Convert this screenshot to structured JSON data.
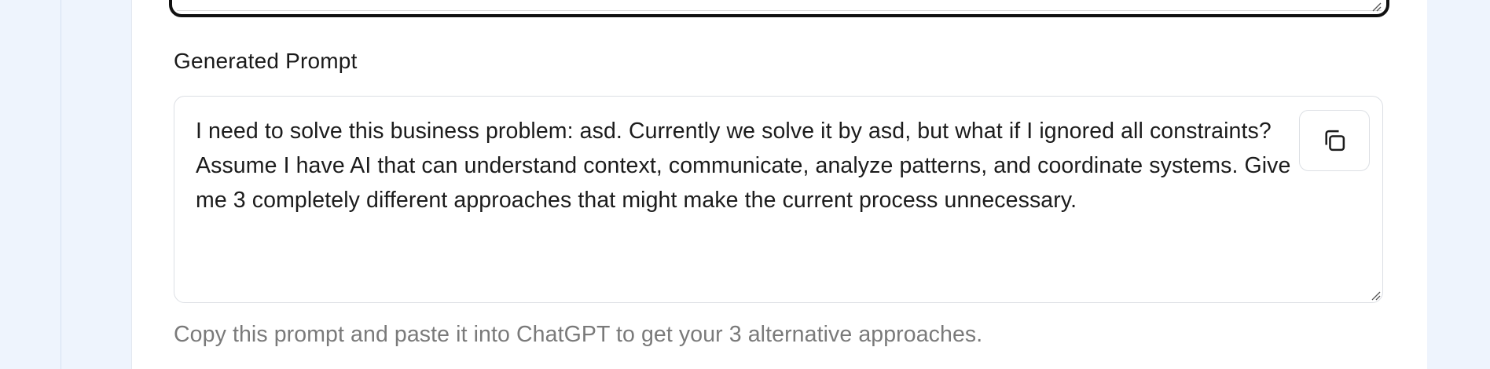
{
  "generated_prompt": {
    "label": "Generated Prompt",
    "text": "I need to solve this business problem: asd. Currently we solve it by asd, but what if I ignored all constraints? Assume I have AI that can understand context, communicate, analyze patterns, and coordinate systems. Give me 3 completely different approaches that might make the current process unnecessary.",
    "copy_icon": "copy-icon",
    "helper": "Copy this prompt and paste it into ChatGPT to get your 3 alternative approaches."
  },
  "colors": {
    "page_background": "#eef4fd",
    "card_background": "#ffffff",
    "focused_border": "#111111",
    "helper_text": "#7a7a7a"
  }
}
